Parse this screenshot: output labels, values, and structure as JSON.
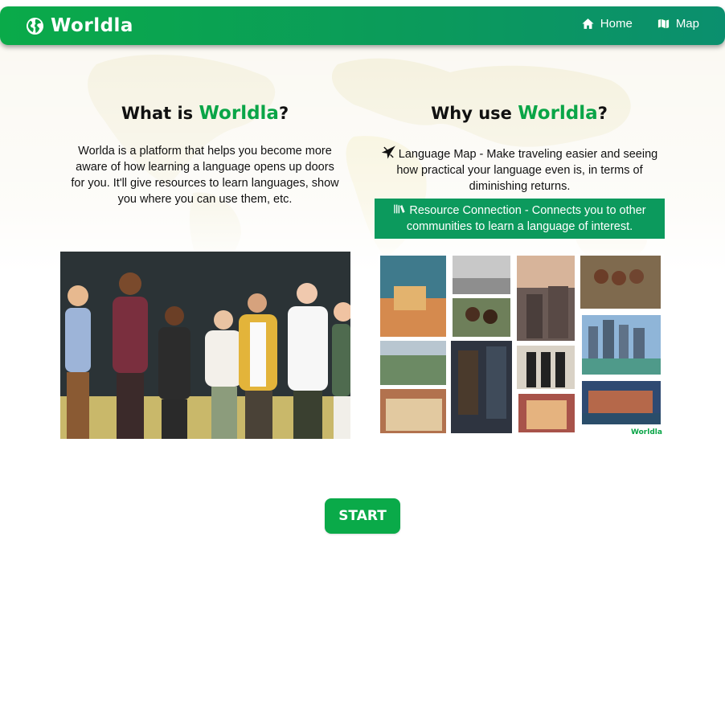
{
  "nav": {
    "brand": "Worldla",
    "links": [
      {
        "label": "Home",
        "icon": "home-icon"
      },
      {
        "label": "Map",
        "icon": "map-icon"
      }
    ]
  },
  "about": {
    "title_prefix": "What is ",
    "title_brand": "Worldla",
    "title_suffix": "?",
    "text": "Worlda is a platform that helps you become more aware of how learning a language opens up doors for you. It'll give resources to learn languages, show you where you can use them, etc."
  },
  "why": {
    "title_prefix": "Why use ",
    "title_brand": "Worldla",
    "title_suffix": "?",
    "features": [
      {
        "icon": "airplane-icon",
        "text": "Language Map - Make traveling easier and seeing how practical your language even is, in terms of diminishing returns."
      },
      {
        "icon": "books-icon",
        "text": "Resource Connection - Connects you to other communities to learn a language of interest."
      }
    ],
    "collage_watermark": "Worldla"
  },
  "start_label": "START",
  "colors": {
    "brand_green": "#0aaa49",
    "nav_teal": "#0b8f6e",
    "feature_green": "#0c9a5d"
  }
}
